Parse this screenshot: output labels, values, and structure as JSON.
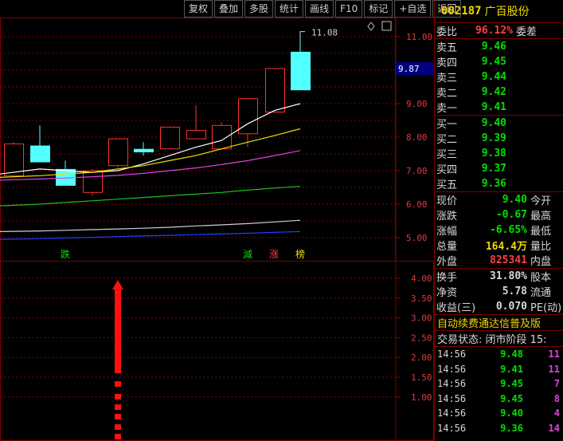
{
  "toolbar": {
    "buttons": [
      "复权",
      "叠加",
      "多股",
      "统计",
      "画线",
      "F10",
      "标记",
      "+自选",
      "返回"
    ]
  },
  "chart": {
    "current_marker": "11.08",
    "price_tag": "9.87",
    "main_axis": [
      "11.00",
      "10.00",
      "9.00",
      "8.00",
      "7.00",
      "6.00",
      "5.00"
    ],
    "sub_axis": [
      "4.00",
      "3.50",
      "3.00",
      "2.50",
      "2.00",
      "1.50",
      "1.00"
    ],
    "signals": [
      {
        "text": "跌",
        "color": "#00e000"
      },
      {
        "text": "減",
        "color": "#00e000"
      },
      {
        "text": "涨",
        "color": "#ff4040"
      },
      {
        "text": "榜",
        "color": "#f0d800"
      }
    ]
  },
  "chart_data": {
    "type": "candlestick",
    "y_range": [
      4.7,
      11.5
    ],
    "candles": [
      {
        "o": 6.85,
        "h": 7.85,
        "l": 6.8,
        "c": 7.8
      },
      {
        "o": 7.75,
        "h": 8.35,
        "l": 7.25,
        "c": 7.25
      },
      {
        "o": 7.05,
        "h": 7.3,
        "l": 6.55,
        "c": 6.55
      },
      {
        "o": 6.35,
        "h": 7.05,
        "l": 6.25,
        "c": 7.0
      },
      {
        "o": 7.15,
        "h": 7.95,
        "l": 7.1,
        "c": 7.95
      },
      {
        "o": 7.65,
        "h": 7.85,
        "l": 7.45,
        "c": 7.55
      },
      {
        "o": 7.65,
        "h": 8.3,
        "l": 7.65,
        "c": 8.3
      },
      {
        "o": 7.95,
        "h": 8.95,
        "l": 7.95,
        "c": 8.2
      },
      {
        "o": 7.65,
        "h": 8.45,
        "l": 7.65,
        "c": 8.35
      },
      {
        "o": 8.1,
        "h": 9.1,
        "l": 7.7,
        "c": 9.15
      },
      {
        "o": 8.75,
        "h": 10.05,
        "l": 8.75,
        "c": 10.05
      },
      {
        "o": 10.55,
        "h": 11.08,
        "l": 9.4,
        "c": 9.4
      }
    ],
    "ma_lines": [
      {
        "color": "#ffffff",
        "points": [
          6.9,
          7.05,
          7.0,
          6.95,
          7.0,
          7.2,
          7.45,
          7.7,
          7.9,
          8.4,
          8.8,
          9.0
        ]
      },
      {
        "color": "#f0e000",
        "points": [
          6.8,
          6.85,
          6.9,
          6.95,
          7.05,
          7.15,
          7.3,
          7.45,
          7.65,
          7.85,
          8.05,
          8.25
        ]
      },
      {
        "color": "#e040e0",
        "points": [
          6.72,
          6.75,
          6.78,
          6.82,
          6.86,
          6.92,
          7.0,
          7.08,
          7.18,
          7.3,
          7.45,
          7.6
        ]
      },
      {
        "color": "#20c020",
        "points": [
          5.95,
          6.0,
          6.05,
          6.1,
          6.15,
          6.2,
          6.25,
          6.3,
          6.35,
          6.42,
          6.48,
          6.53
        ]
      },
      {
        "color": "#d0d0d0",
        "points": [
          5.18,
          5.2,
          5.22,
          5.24,
          5.26,
          5.28,
          5.31,
          5.35,
          5.38,
          5.42,
          5.47,
          5.52
        ]
      },
      {
        "color": "#2040ff",
        "points": [
          4.95,
          4.97,
          4.99,
          5.01,
          5.03,
          5.05,
          5.07,
          5.09,
          5.11,
          5.13,
          5.16,
          5.18
        ]
      }
    ]
  },
  "quote": {
    "code": "002187",
    "name": "广百股份",
    "weibi_label": "委比",
    "weibi_value": "96.12%",
    "weicha_label": "委差",
    "asks": [
      {
        "label": "卖五",
        "price": "9.46"
      },
      {
        "label": "卖四",
        "price": "9.45"
      },
      {
        "label": "卖三",
        "price": "9.44"
      },
      {
        "label": "卖二",
        "price": "9.42"
      },
      {
        "label": "卖一",
        "price": "9.41"
      }
    ],
    "bids": [
      {
        "label": "买一",
        "price": "9.40"
      },
      {
        "label": "买二",
        "price": "9.39"
      },
      {
        "label": "买三",
        "price": "9.38"
      },
      {
        "label": "买四",
        "price": "9.37"
      },
      {
        "label": "买五",
        "price": "9.36"
      }
    ],
    "stats1": [
      {
        "label": "现价",
        "value": "9.40",
        "label2": "今开",
        "color": "g"
      },
      {
        "label": "涨跌",
        "value": "-0.67",
        "label2": "最高",
        "color": "g"
      },
      {
        "label": "涨幅",
        "value": "-6.65%",
        "label2": "最低",
        "color": "g"
      },
      {
        "label": "总量",
        "value": "164.4万",
        "label2": "量比",
        "color": "y"
      },
      {
        "label": "外盘",
        "value": "825341",
        "label2": "内盘",
        "color": "r"
      }
    ],
    "stats2": [
      {
        "label": "换手",
        "value": "31.80%",
        "label2": "股本",
        "color": "w"
      },
      {
        "label": "净资",
        "value": "5.78",
        "label2": "流通",
        "color": "w"
      },
      {
        "label": "收益(三)",
        "value": "0.070",
        "label2": "PE(动)",
        "color": "w"
      }
    ],
    "notice": "自动续费通达信普及版",
    "status": "交易状态: 闭市阶段 15:",
    "trades": [
      {
        "time": "14:56",
        "price": "9.48",
        "vol": "11",
        "color": "g"
      },
      {
        "time": "14:56",
        "price": "9.41",
        "vol": "11",
        "color": "g"
      },
      {
        "time": "14:56",
        "price": "9.45",
        "vol": "7",
        "color": "g"
      },
      {
        "time": "14:56",
        "price": "9.45",
        "vol": "8",
        "color": "g"
      },
      {
        "time": "14:56",
        "price": "9.40",
        "vol": "4",
        "color": "g"
      },
      {
        "time": "14:56",
        "price": "9.36",
        "vol": "14",
        "color": "g"
      }
    ]
  }
}
